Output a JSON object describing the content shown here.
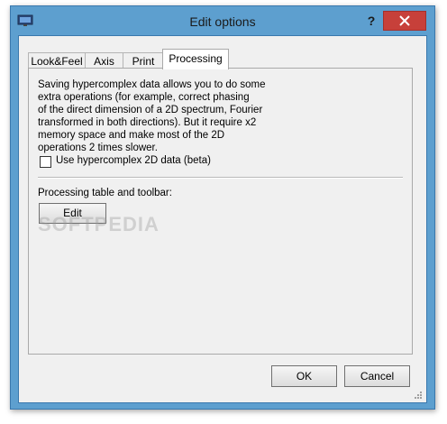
{
  "window": {
    "title": "Edit options",
    "help_label": "?"
  },
  "tabs": [
    {
      "label": "Look&Feel",
      "active": false
    },
    {
      "label": "Axis",
      "active": false
    },
    {
      "label": "Print",
      "active": false
    },
    {
      "label": "Processing",
      "active": true
    }
  ],
  "processing": {
    "description_lines": [
      "Saving hypercomplex data allows you to do some",
      "extra operations (for example, correct phasing",
      "of the direct dimension of a 2D spectrum, Fourier",
      "transformed in both directions). But it require x2",
      "memory space and make most of the 2D",
      "operations 2 times slower."
    ],
    "checkbox_label": "Use hypercomplex 2D data (beta)",
    "checkbox_checked": false,
    "table_label": "Processing table and toolbar:",
    "edit_label": "Edit"
  },
  "footer": {
    "ok_label": "OK",
    "cancel_label": "Cancel"
  },
  "watermark": "SOFTPEDIA",
  "colors": {
    "title_bar": "#5d9fcf",
    "close_button": "#c7403a",
    "dialog_background": "#f0f0f0"
  }
}
